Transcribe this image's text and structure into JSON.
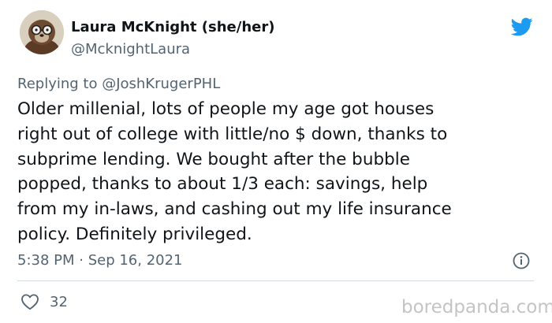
{
  "author": {
    "display_name": "Laura McKnight (she/her)",
    "handle": "@McknightLaura",
    "avatar": "otter-with-glasses-avatar"
  },
  "reply": {
    "prefix": "Replying to ",
    "mention": "@JoshKrugerPHL"
  },
  "tweet": {
    "text": "Older millenial, lots of people my age got houses\nright out of college with little/no $ down, thanks to\nsubprime lending. We bought after the bubble\npopped, thanks to about 1/3 each: savings, help\nfrom my in-laws, and cashing out my life insurance\npolicy. Definitely privileged.",
    "timestamp": "5:38 PM · Sep 16, 2021"
  },
  "actions": {
    "like_count": "32"
  },
  "watermark": "boredpanda.com",
  "icons": {
    "brand": "twitter-bird-icon",
    "info": "info-icon",
    "like": "heart-icon"
  },
  "colors": {
    "twitter_blue": "#1d9bf0",
    "text_primary": "#0f1419",
    "text_secondary": "#536471",
    "divider": "#cfd9de",
    "watermark": "#c4c4c4"
  }
}
